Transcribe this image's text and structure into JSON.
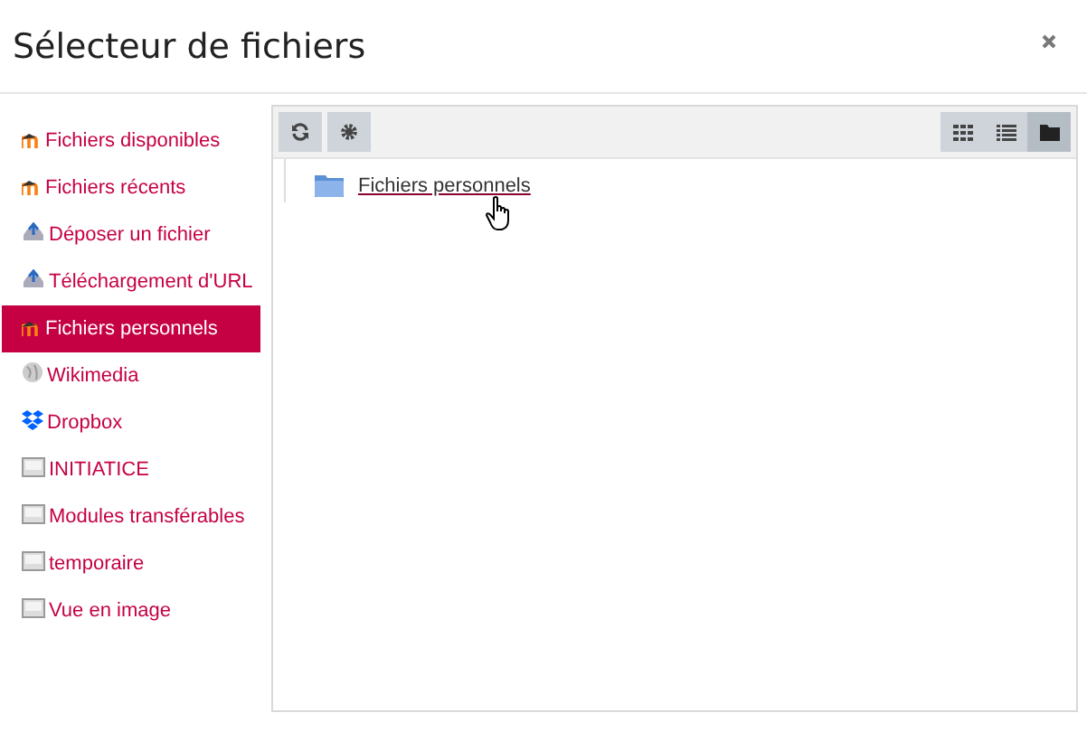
{
  "window": {
    "title": "Sélecteur de fichiers"
  },
  "sidebar": {
    "items": [
      {
        "label": "Fichiers disponibles",
        "kind": "moodle",
        "selected": false
      },
      {
        "label": "Fichiers récents",
        "kind": "moodle",
        "selected": false
      },
      {
        "label": "Déposer un fichier",
        "kind": "upload",
        "selected": false
      },
      {
        "label": "Téléchargement d'URL",
        "kind": "upload",
        "selected": false
      },
      {
        "label": "Fichiers personnels",
        "kind": "moodle",
        "selected": true
      },
      {
        "label": "Wikimedia",
        "kind": "globe",
        "selected": false
      },
      {
        "label": "Dropbox",
        "kind": "dropbox",
        "selected": false
      },
      {
        "label": "INITIATICE",
        "kind": "repo",
        "selected": false
      },
      {
        "label": "Modules transférables",
        "kind": "repo",
        "selected": false
      },
      {
        "label": "temporaire",
        "kind": "repo",
        "selected": false
      },
      {
        "label": "Vue en image",
        "kind": "repo",
        "selected": false
      }
    ]
  },
  "toolbar": {
    "views": [
      {
        "kind": "icons",
        "selected": false
      },
      {
        "kind": "list",
        "selected": false
      },
      {
        "kind": "tree",
        "selected": true
      }
    ]
  },
  "files": [
    {
      "name": "Fichiers personnels"
    }
  ]
}
